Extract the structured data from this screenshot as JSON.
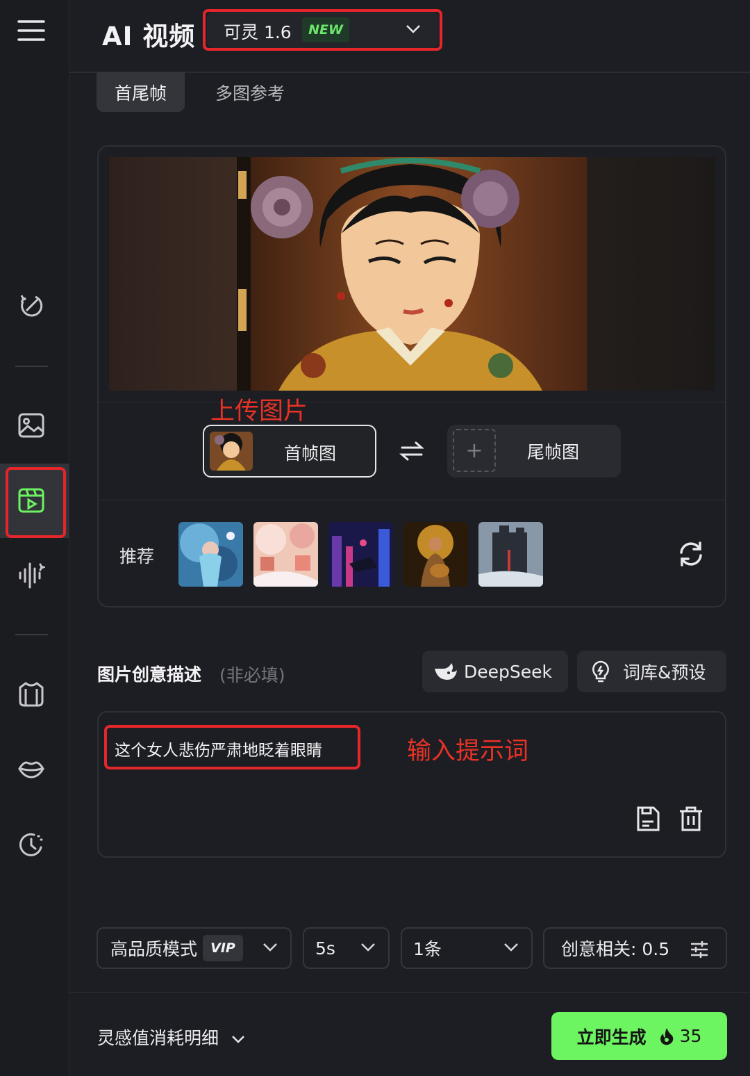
{
  "header": {
    "title": "AI 视频",
    "model": {
      "name": "可灵 1.6",
      "badge": "NEW"
    }
  },
  "tabs": [
    {
      "label": "首尾帧",
      "active": true
    },
    {
      "label": "多图参考",
      "active": false
    }
  ],
  "sidebar": {
    "icons": [
      "menu-icon",
      "magic-edit-icon",
      "image-icon",
      "video-icon",
      "audio-wave-icon",
      "shirt-icon",
      "lips-icon",
      "history-icon"
    ],
    "active": "video-icon"
  },
  "frames": {
    "annotation": "上传图片",
    "first_label": "首帧图",
    "last_label": "尾帧图"
  },
  "recommend": {
    "label": "推荐",
    "thumbnails": [
      "mermaid-thumb",
      "candy-town-thumb",
      "cyber-city-thumb",
      "guitar-woman-thumb",
      "dark-tower-thumb"
    ]
  },
  "description": {
    "title": "图片创意描述",
    "optional": "(非必填)",
    "deepseek_label": "DeepSeek",
    "library_label": "词库&预设",
    "prompt": "这个女人悲伤严肃地眨着眼睛",
    "annotation": "输入提示词"
  },
  "options": {
    "mode": "高品质模式",
    "mode_badge": "VIP",
    "duration": "5s",
    "count": "1条",
    "creativity": "创意相关: 0.5"
  },
  "footer": {
    "cost_label": "灵感值消耗明细",
    "generate_label": "立即生成",
    "cost_value": "35"
  },
  "colors": {
    "accent": "#6cf461",
    "annotation_red": "#e83226",
    "background": "#1d1e23"
  }
}
